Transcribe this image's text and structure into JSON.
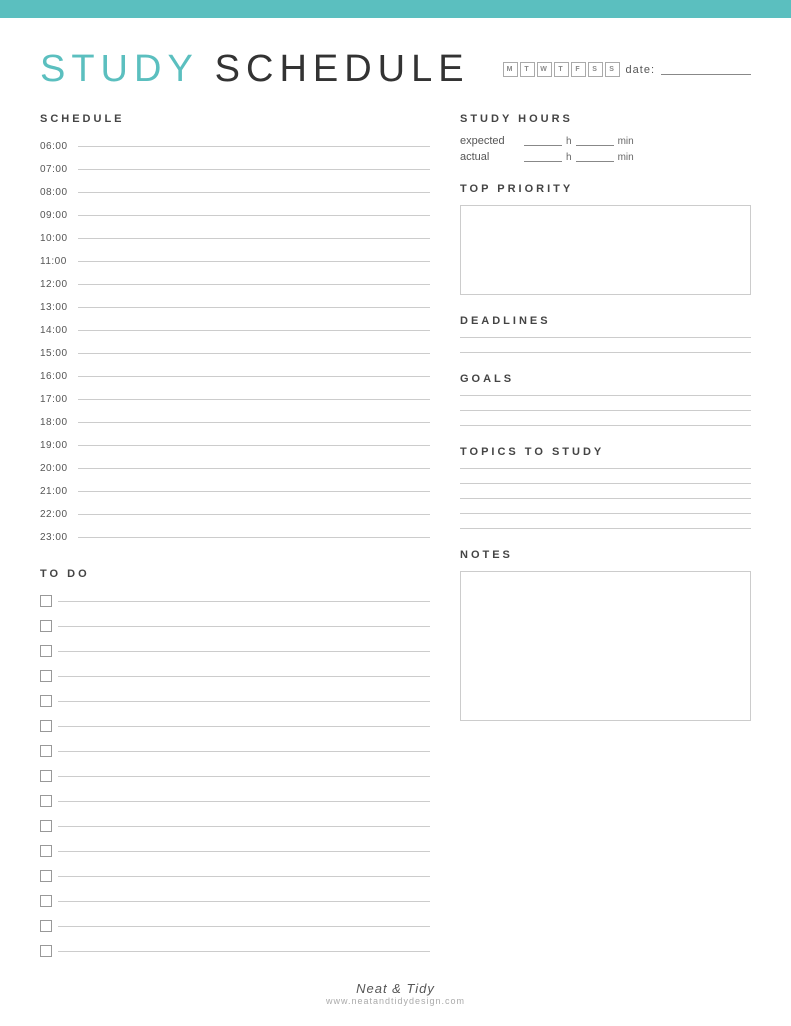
{
  "topBar": {},
  "header": {
    "title_highlight": "STUDY",
    "title_rest": " SCHEDULE",
    "days": [
      "M",
      "T",
      "W",
      "T",
      "F",
      "S",
      "S"
    ],
    "date_label": "date:"
  },
  "left": {
    "schedule_title": "SCHEDULE",
    "times": [
      "06:00",
      "07:00",
      "08:00",
      "09:00",
      "10:00",
      "11:00",
      "12:00",
      "13:00",
      "14:00",
      "15:00",
      "16:00",
      "17:00",
      "18:00",
      "19:00",
      "20:00",
      "21:00",
      "22:00",
      "23:00"
    ],
    "todo_title": "TO DO",
    "todo_count": 15
  },
  "right": {
    "study_hours_title": "STUDY HOURS",
    "expected_label": "expected",
    "actual_label": "actual",
    "h_label": "h",
    "min_label": "min",
    "top_priority_title": "TOP PRIORITY",
    "deadlines_title": "DEADLINES",
    "deadlines_lines": 2,
    "goals_title": "GOALS",
    "goals_lines": 3,
    "topics_title": "TOPICS TO STUDY",
    "topics_lines": 5,
    "notes_title": "NOTES"
  },
  "footer": {
    "brand": "Neat & Tidy",
    "url": "www.neatandtidydesign.com"
  }
}
